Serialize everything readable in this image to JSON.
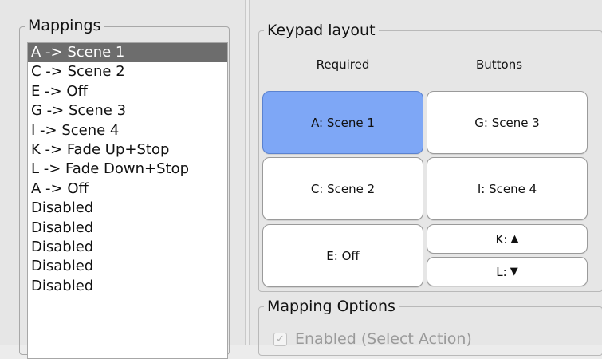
{
  "mappings": {
    "title": "Mappings",
    "items": [
      {
        "label": "A -> Scene 1",
        "selected": true
      },
      {
        "label": "C -> Scene 2"
      },
      {
        "label": "E -> Off"
      },
      {
        "label": "G -> Scene 3"
      },
      {
        "label": "I -> Scene 4"
      },
      {
        "label": "K -> Fade Up+Stop"
      },
      {
        "label": "L -> Fade Down+Stop"
      },
      {
        "label": "A -> Off"
      },
      {
        "label": "Disabled"
      },
      {
        "label": "Disabled"
      },
      {
        "label": "Disabled"
      },
      {
        "label": "Disabled"
      },
      {
        "label": "Disabled"
      }
    ]
  },
  "keypad": {
    "title": "Keypad layout",
    "col_required": "Required",
    "col_buttons": "Buttons",
    "keys": {
      "a": "A: Scene 1",
      "g": "G: Scene 3",
      "c": "C: Scene 2",
      "i": "I: Scene 4",
      "e": "E: Off",
      "k": "K:",
      "l": "L:"
    },
    "up_arrow": "▲",
    "down_arrow": "▼"
  },
  "options": {
    "title": "Mapping Options",
    "enabled_label": "Enabled (Select Action)",
    "enabled_checked": true
  }
}
